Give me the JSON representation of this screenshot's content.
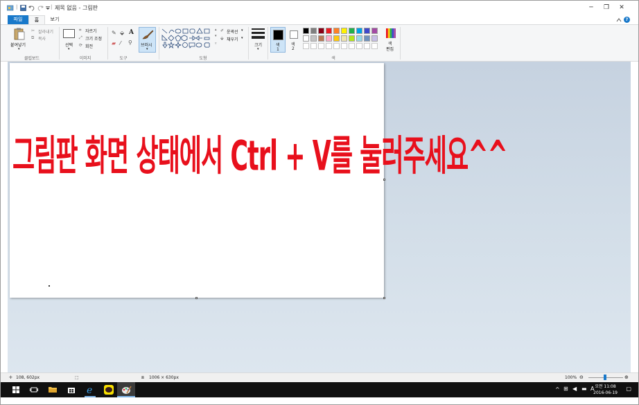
{
  "titlebar": {
    "title": "제목 없음 - 그림판",
    "minimize": "─",
    "restore": "❐",
    "close": "✕"
  },
  "tabs": {
    "file": "파일",
    "home": "홈",
    "view": "보기"
  },
  "ribbon": {
    "clipboard": {
      "paste": "붙여넣기",
      "cut": "잘라내기",
      "copy": "복사",
      "group": "클립보드"
    },
    "image": {
      "select": "선택",
      "crop": "자르기",
      "resize": "크기 조정",
      "rotate": "회전",
      "group": "이미지"
    },
    "tools": {
      "group": "도구"
    },
    "brushes": {
      "label": "브러시"
    },
    "shapes": {
      "outline": "윤곽선",
      "fill": "채우기",
      "group": "도형"
    },
    "size": {
      "label": "크기"
    },
    "colors": {
      "color1": "색",
      "color1_num": "1",
      "color2": "색",
      "color2_num": "2",
      "edit": "색",
      "edit2": "편집",
      "group": "색"
    },
    "palette_row1": [
      "#000000",
      "#7f7f7f",
      "#880015",
      "#ed1c24",
      "#ff7f27",
      "#fff200",
      "#22b14c",
      "#00a2e8",
      "#3f48cc",
      "#a349a4"
    ],
    "palette_row2": [
      "#ffffff",
      "#c3c3c3",
      "#b97a57",
      "#ffaec9",
      "#ffc90e",
      "#efe4b0",
      "#b5e61d",
      "#99d9ea",
      "#7092be",
      "#c8bfe7"
    ]
  },
  "canvas": {
    "text": "그림판 화면 상태에서 Ctrl + V를 눌러주세요^^"
  },
  "status": {
    "cursor": "108, 602px",
    "selection_icon": "⬚",
    "size": "1006 × 630px",
    "zoom": "100%"
  },
  "tray": {
    "time": "오전 11:08",
    "date": "2016-06-19",
    "ime": "A"
  }
}
